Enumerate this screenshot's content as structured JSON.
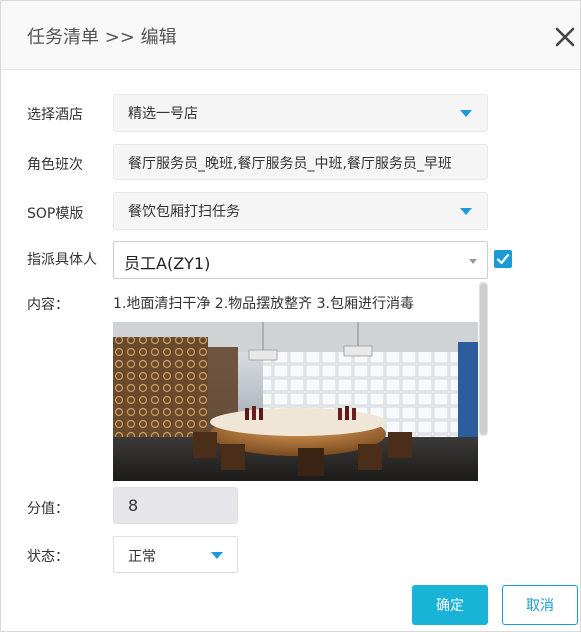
{
  "dialog": {
    "title": "任务清单 >> 编辑",
    "close_icon": "close-icon"
  },
  "form": {
    "hotel": {
      "label": "选择酒店",
      "value": "精选一号店"
    },
    "shift": {
      "label": "角色班次",
      "value": "餐厅服务员_晚班,餐厅服务员_中班,餐厅服务员_早班"
    },
    "sop": {
      "label": "SOP模版",
      "value": "餐饮包厢打扫任务"
    },
    "assign": {
      "label": "指派具体人",
      "value": "员工A(ZY1)",
      "checked": true
    },
    "content": {
      "label": "内容：",
      "text": "1.地面清扫干净 2.物品摆放整齐 3.包厢进行消毒",
      "image_alt": "restaurant private room photo"
    },
    "score": {
      "label": "分值：",
      "value": "8"
    },
    "status": {
      "label": "状态：",
      "value": "正常"
    }
  },
  "buttons": {
    "confirm": "确定",
    "cancel": "取消"
  },
  "colors": {
    "accent": "#1a9bd8",
    "confirm_bg": "#1ab3d8",
    "field_bg": "#f5f5f5",
    "header_bg": "#f8f8f8"
  }
}
